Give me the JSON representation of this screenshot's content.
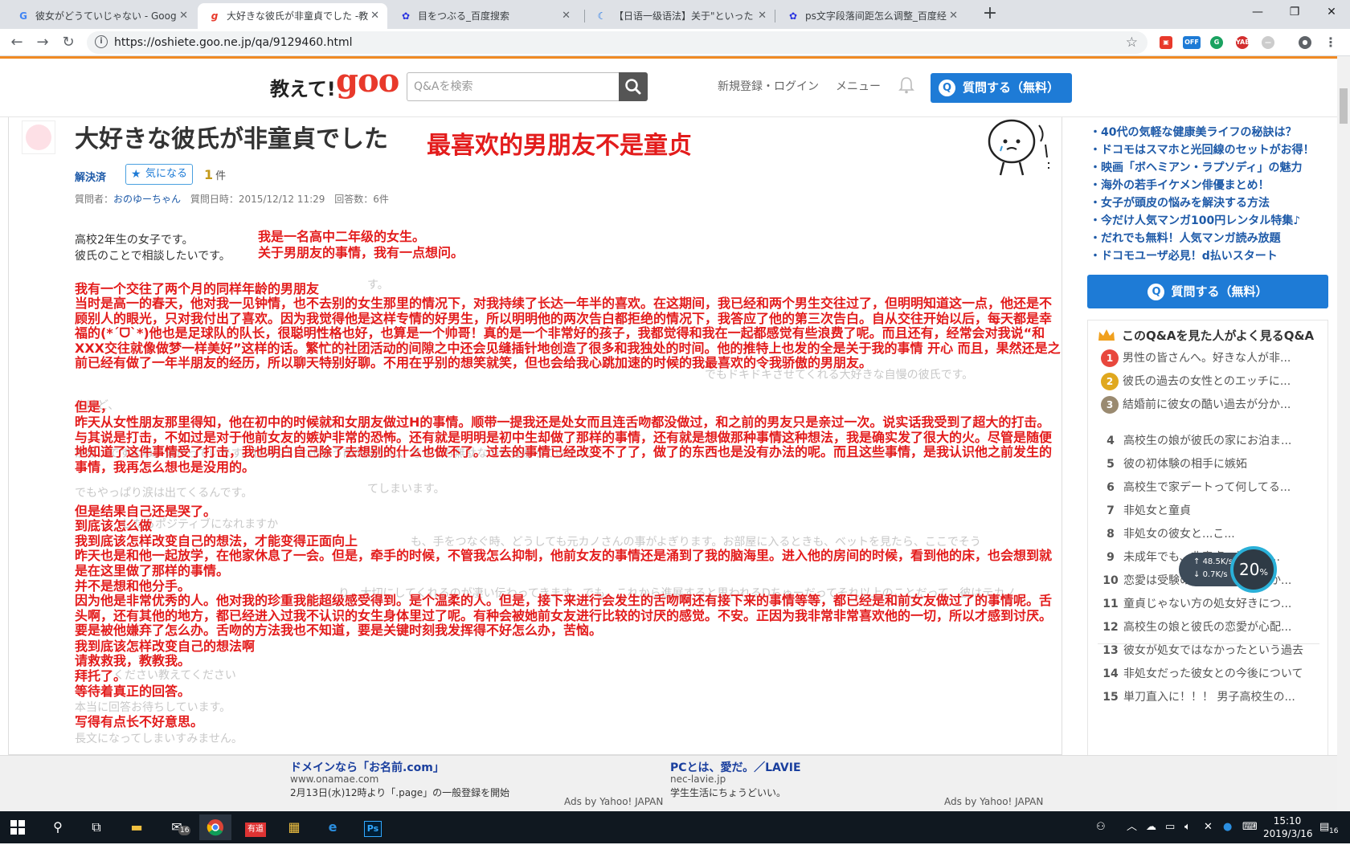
{
  "browser": {
    "tabs": [
      {
        "title": "彼女がどうていじゃない - Goog",
        "favicon": "G",
        "active": false
      },
      {
        "title": "大好きな彼氏が非童貞でした -教",
        "favicon": "g",
        "active": true
      },
      {
        "title": "目をつぶる_百度搜索",
        "favicon": "paw",
        "active": false
      },
      {
        "title": "【日语一级语法】关于\"といった",
        "favicon": "(",
        "active": false
      },
      {
        "title": "ps文字段落间距怎么调整_百度经",
        "favicon": "paw",
        "active": false
      }
    ],
    "url": "https://oshiete.goo.ne.jp/qa/9129460.html"
  },
  "header": {
    "logo_text": "教えて!",
    "logo_brand": "goo",
    "search_placeholder": "Q&Aを検索",
    "register_link": "新規登録・ログイン",
    "menu_link": "メニュー",
    "ask_button": "質問する（無料）",
    "ask_q": "Q"
  },
  "question": {
    "title": "大好きな彼氏が非童貞でした",
    "title_translation": "最喜欢的男朋友不是童贞",
    "status": "解決済",
    "interest_label": "気になる",
    "interest_count": "1",
    "interest_unit": "件",
    "meta_asker_label": "質問者：",
    "meta_asker": "おのゆーちゃん",
    "meta_date": "質問日時：2015/12/12 11:29",
    "meta_answers": "回答数：6件",
    "jp_line1": "高校2年生の女子です。",
    "jp_line2": "彼氏のことで相談したいです。",
    "cn_line1": "我是一名高中二年级的女生。",
    "cn_line2": "关于男朋友的事情，我有一点想问。",
    "ghost": [
      "す。",
      "すけど、",
      "でもドキドキさせてくれる大好きな自慢の彼氏です。",
      "てしまいます。",
      "がないですよね。分かっています。仕方ないと出会う前の話だし、考えても無駄なのも分かっています。",
      "でもやっぱり涙は出てくるんです。",
      "したらポジティブになれますか",
      "も、手をつなぐ時、どうしても元カノさんの事がよぎります。お部屋に入るときも、ベットを見たら、ここでそう",
      "り、大切にしてくれるのが凄い伝わってきます。でも、これから進展すると思われるDちゅーだってそれ以上のことだって、彼はテカノ",
      "です",
      "ください教えてください",
      "本当に回答お待ちしています。",
      "長文になってしまいすみません。"
    ],
    "cn_p1_head": "我有一个交往了两个月的同样年龄的男朋友",
    "cn_p1": "当时是高一的春天，他对我一见钟情，也不去别的女生那里的情况下，对我持续了长达一年半的喜欢。在这期间，我已经和两个男生交往过了，但明明知道这一点，他还是不顾别人的眼光，只对我付出了喜欢。因为我觉得他是这样专情的好男生，所以明明他的两次告白都拒绝的情况下，我答应了他的第三次告白。自从交往开始以后，每天都是幸福的(*ˊᗜˋ*)他也是足球队的队长，很聪明性格也好，也算是一个帅哥！真的是一个非常好的孩子，我都觉得和我在一起都感觉有些浪费了呢。而且还有，经常会对我说“和XXX交往就像做梦一样美好”这样的话。繁忙的社团活动的间隙之中还会见缝插针地创造了很多和我独处的时间。他的推特上也发的全是关于我的事情 开心 而且，果然还是之前已经有做了一年半朋友的经历，所以聊天特别好聊。不用在乎别的想笑就笑，但也会给我心跳加速的时候的我最喜欢的令我骄傲的男朋友。",
    "cn_p2_head": "但是，",
    "cn_p2": "昨天从女性朋友那里得知，他在初中的时候就和女朋友做过H的事情。顺带一提我还是处女而且连舌吻都没做过，和之前的男友只是亲过一次。说实话我受到了超大的打击。与其说是打击，不如过是对于他前女友的嫉妒非常的恐怖。还有就是明明是初中生却做了那样的事情，还有就是想做那种事情这种想法，我是确实发了很大的火。尽管是随便地知道了这件事情受了打击，我也明白自己除了去想别的什么也做不了。过去的事情已经改变不了了，做了的东西也是没有办法的呢。而且这些事情，是我认识他之前发生的事情，我再怎么想也是没用的。",
    "cn_p3_lines": [
      "但是结果自己还是哭了。",
      "到底该怎么做",
      "我到底该怎样改变自己的想法，才能变得正面向上"
    ],
    "cn_p4": "昨天也是和他一起放学，在他家休息了一会。但是，牵手的时候，不管我怎么抑制，他前女友的事情还是涌到了我的脑海里。进入他的房间的时候，看到他的床，也会想到就是在这里做了那样的事情。",
    "cn_p5_line": "并不是想和他分手。",
    "cn_p5": "因为他是非常优秀的人。他对我的珍重我能超级感受得到。是个温柔的人。但是，接下来进行会发生的舌吻啊还有接下来的事情等等，都已经是和前女友做过了的事情呢。舌头啊，还有其他的地方，都已经进入过我不认识的女生身体里过了呢。有种会被她前女友进行比较的讨厌的感觉。不安。正因为我非常非常喜欢他的一切，所以才感到讨厌。要是被他嫌弃了怎么办。舌吻的方法我也不知道，要是关键时刻我发挥得不好怎么办，苦恼。",
    "cn_p6_lines": [
      "我到底该怎样改变自己的想法啊",
      "请救救我，教教我。",
      "拜托了。",
      "等待着真正的回答。"
    ],
    "cn_p7": "写得有点长不好意思。"
  },
  "sidebar": {
    "links": [
      "・40代の気軽な健康美ライフの秘訣は？",
      "・ドコモはスマホと光回線のセットがお得！",
      "・映画「ボヘミアン・ラプソディ」の魅力",
      "・海外の若手イケメン俳優まとめ！",
      "・女子が頭皮の悩みを解決する方法",
      "・今だけ人気マンガ100円レンタル特集♪",
      "・だれでも無料！人気マンガ読み放題",
      "・ドコモユーザ必見！d払いスタート"
    ],
    "ask_button": "質問する（無料）",
    "ask_q": "Q",
    "ranking_title": "このQ&Aを見た人がよく見るQ&A",
    "ranking": [
      {
        "rank": "1",
        "title": "男性の皆さんへ。好きな人が非..."
      },
      {
        "rank": "2",
        "title": "彼氏の過去の女性とのエッチに..."
      },
      {
        "rank": "3",
        "title": "結婚前に彼女の酷い過去が分か..."
      },
      {
        "rank": "4",
        "title": "高校生の娘が彼氏の家にお泊ま..."
      },
      {
        "rank": "5",
        "title": "彼の初体験の相手に嫉妬"
      },
      {
        "rank": "6",
        "title": "高校生で家デートって何してる..."
      },
      {
        "rank": "7",
        "title": "非処女と童貞"
      },
      {
        "rank": "8",
        "title": "非処女の彼女と...こ..."
      },
      {
        "rank": "9",
        "title": "未成年でも、非童貞、処女は..."
      },
      {
        "rank": "10",
        "title": "恋愛は受験の妨げになりますか..."
      },
      {
        "rank": "11",
        "title": "童貞じゃない方の処女好きにつ..."
      },
      {
        "rank": "12",
        "title": "高校生の娘と彼氏の恋愛が心配..."
      },
      {
        "rank": "13",
        "title": "彼女が処女ではなかったという過去"
      },
      {
        "rank": "14",
        "title": "非処女だった彼女との今後について"
      },
      {
        "rank": "15",
        "title": "単刀直入に！！！ 男子高校生の..."
      }
    ],
    "rank_colors": {
      "1": "#e8473d",
      "2": "#e0a81e",
      "3": "#9a8a70"
    }
  },
  "ads": [
    {
      "title": "ドメインなら「お名前.com」",
      "url": "www.onamae.com",
      "desc": "2月13日(水)12時より「.page」の一般登録を開始",
      "by": "Ads by Yahoo! JAPAN"
    },
    {
      "title": "PCとは、愛だ。／LAVIE",
      "url": "nec-lavie.jp",
      "desc": "学生生活にちょうどいい。",
      "by": "Ads by Yahoo! JAPAN"
    }
  ],
  "net_widget": {
    "up": "48.5K/s",
    "down": "0.7K/s",
    "percent": "20",
    "percent_unit": "%"
  },
  "taskbar": {
    "mail_badge": "16",
    "youdao": "有道",
    "ps": "Ps",
    "time": "15:10",
    "date": "2019/3/16",
    "notif_badge": "16"
  },
  "colors": {
    "accent": "#1e7bd6",
    "brand_red": "#e8392b",
    "translation_red": "#e31c1c",
    "orange": "#f08a24"
  }
}
